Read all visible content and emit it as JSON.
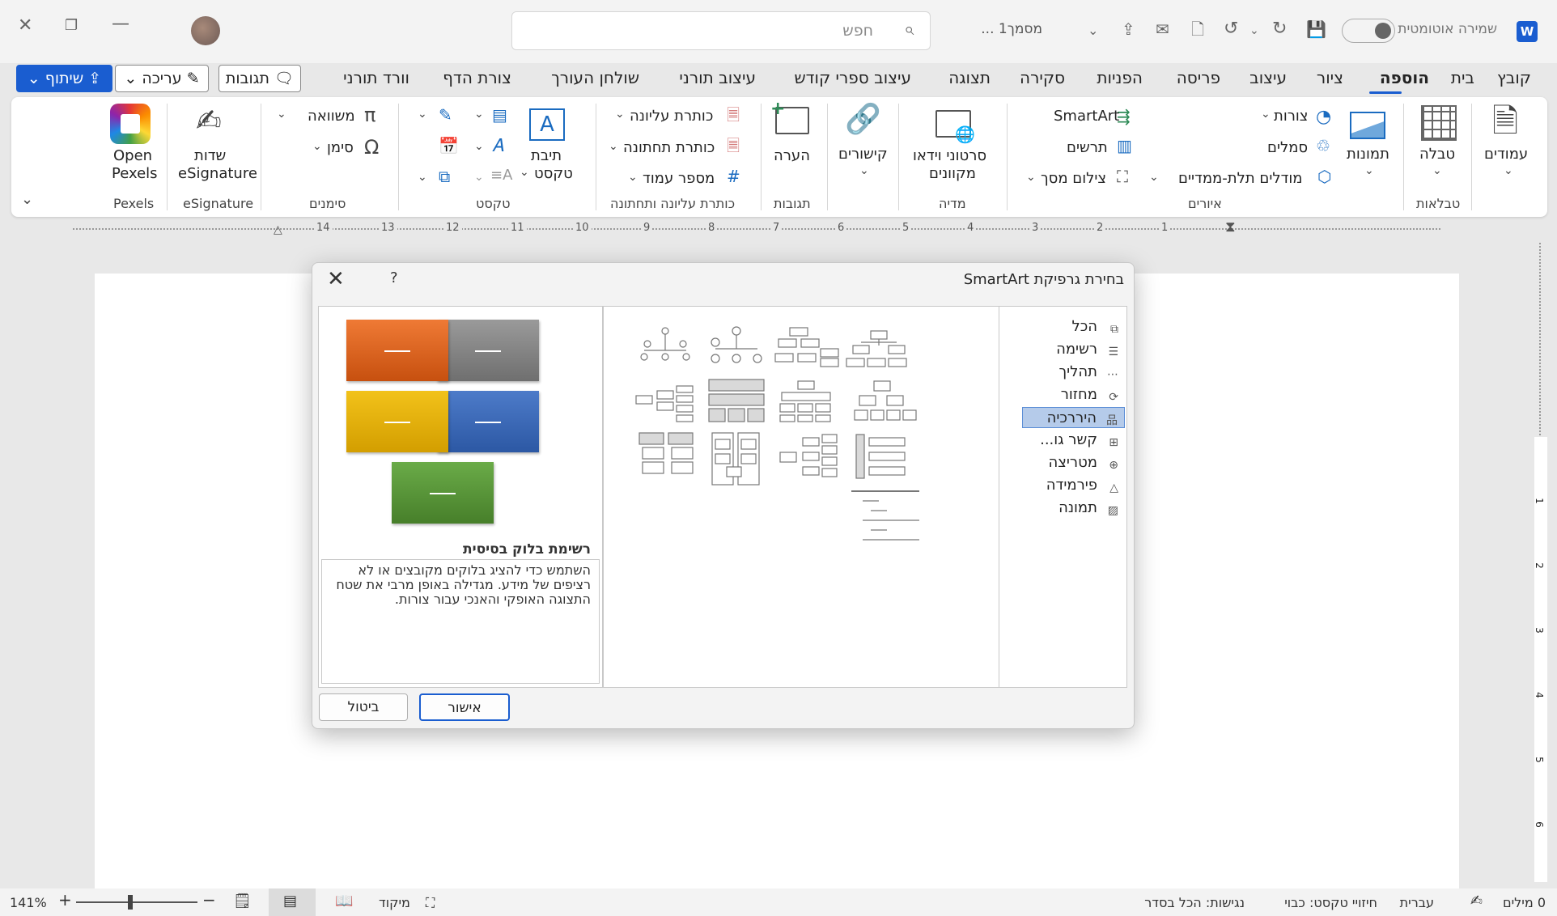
{
  "titlebar": {
    "autosave_label": "שמירה אוטומטית",
    "doc_title": "מסמך1 ...",
    "search_placeholder": "חפש",
    "app_icon": "W"
  },
  "tabs": [
    "קובץ",
    "בית",
    "הוספה",
    "ציור",
    "עיצוב",
    "פריסה",
    "הפניות",
    "סקירה",
    "תצוגה",
    "עיצוב ספרי קודש",
    "עיצוב תורני",
    "שולחן העורך",
    "צורת הדף",
    "וורד תורני"
  ],
  "header_buttons": {
    "comments": "תגובות",
    "editing": "עריכה",
    "share": "שיתוף"
  },
  "ribbon": {
    "pages": "עמודים",
    "table": "טבלה",
    "tables_group": "טבלאות",
    "pictures": "תמונות",
    "shapes": "צורות",
    "icons": "סמלים",
    "models3d": "מודלים תלת-ממדיים",
    "smartart": "SmartArt",
    "chart": "תרשים",
    "screenshot": "צילום מסך",
    "illustrations_group": "איורים",
    "online_video_1": "סרטוני וידאו",
    "online_video_2": "מקוונים",
    "media_group": "מדיה",
    "links": "קישורים",
    "comment": "הערה",
    "comments_group": "תגובות",
    "header": "כותרת עליונה",
    "footer": "כותרת תחתונה",
    "page_number": "מספר עמוד",
    "header_footer_group": "כותרת עליונה ותחתונה",
    "textbox_1": "תיבת",
    "textbox_2": "טקסט",
    "text_group": "טקסט",
    "equation": "משוואה",
    "symbol": "סימן",
    "symbols_group": "סימנים",
    "esig_1": "שדות",
    "esig_2": "eSignature",
    "esig_group": "eSignature",
    "pexels_1": "Open",
    "pexels_2": "Pexels",
    "pexels_group": "Pexels"
  },
  "ruler": [
    "1",
    "2",
    "3",
    "4",
    "5",
    "6",
    "7",
    "8",
    "9",
    "10",
    "11",
    "12",
    "13",
    "14"
  ],
  "vruler": [
    "1",
    "2",
    "3",
    "4",
    "5",
    "6"
  ],
  "dialog": {
    "title": "בחירת גרפיקת SmartArt",
    "help": "?",
    "categories": [
      {
        "label": "הכל",
        "icon": "all-icon"
      },
      {
        "label": "רשימה",
        "icon": "list-icon"
      },
      {
        "label": "תהליך",
        "icon": "process-icon"
      },
      {
        "label": "מחזור",
        "icon": "cycle-icon"
      },
      {
        "label": "היררכיה",
        "icon": "hierarchy-icon"
      },
      {
        "label": "קשר גו...",
        "icon": "relationship-icon"
      },
      {
        "label": "מטריצה",
        "icon": "matrix-icon"
      },
      {
        "label": "פירמידה",
        "icon": "pyramid-icon"
      },
      {
        "label": "תמונה",
        "icon": "picture-icon"
      }
    ],
    "selected_category": "היררכיה",
    "preview_name": "רשימת בלוק בסיסית",
    "preview_description": "השתמש כדי להציג בלוקים מקובצים או לא רציפים של מידע. מגדילה באופן מרבי את שטח התצוגה האופקי והאנכי עבור צורות.",
    "preview_colors": [
      "#e0661e",
      "#8a8a8a",
      "#e8b000",
      "#3a66b8",
      "#5b9a3c"
    ],
    "ok": "אישור",
    "cancel": "ביטול"
  },
  "statusbar": {
    "words": "0 מילים",
    "language": "עברית",
    "text_predictions": "חיזויי טקסט: כבוי",
    "accessibility": "נגישות: הכל בסדר",
    "focus": "מיקוד",
    "zoom": "141%"
  }
}
